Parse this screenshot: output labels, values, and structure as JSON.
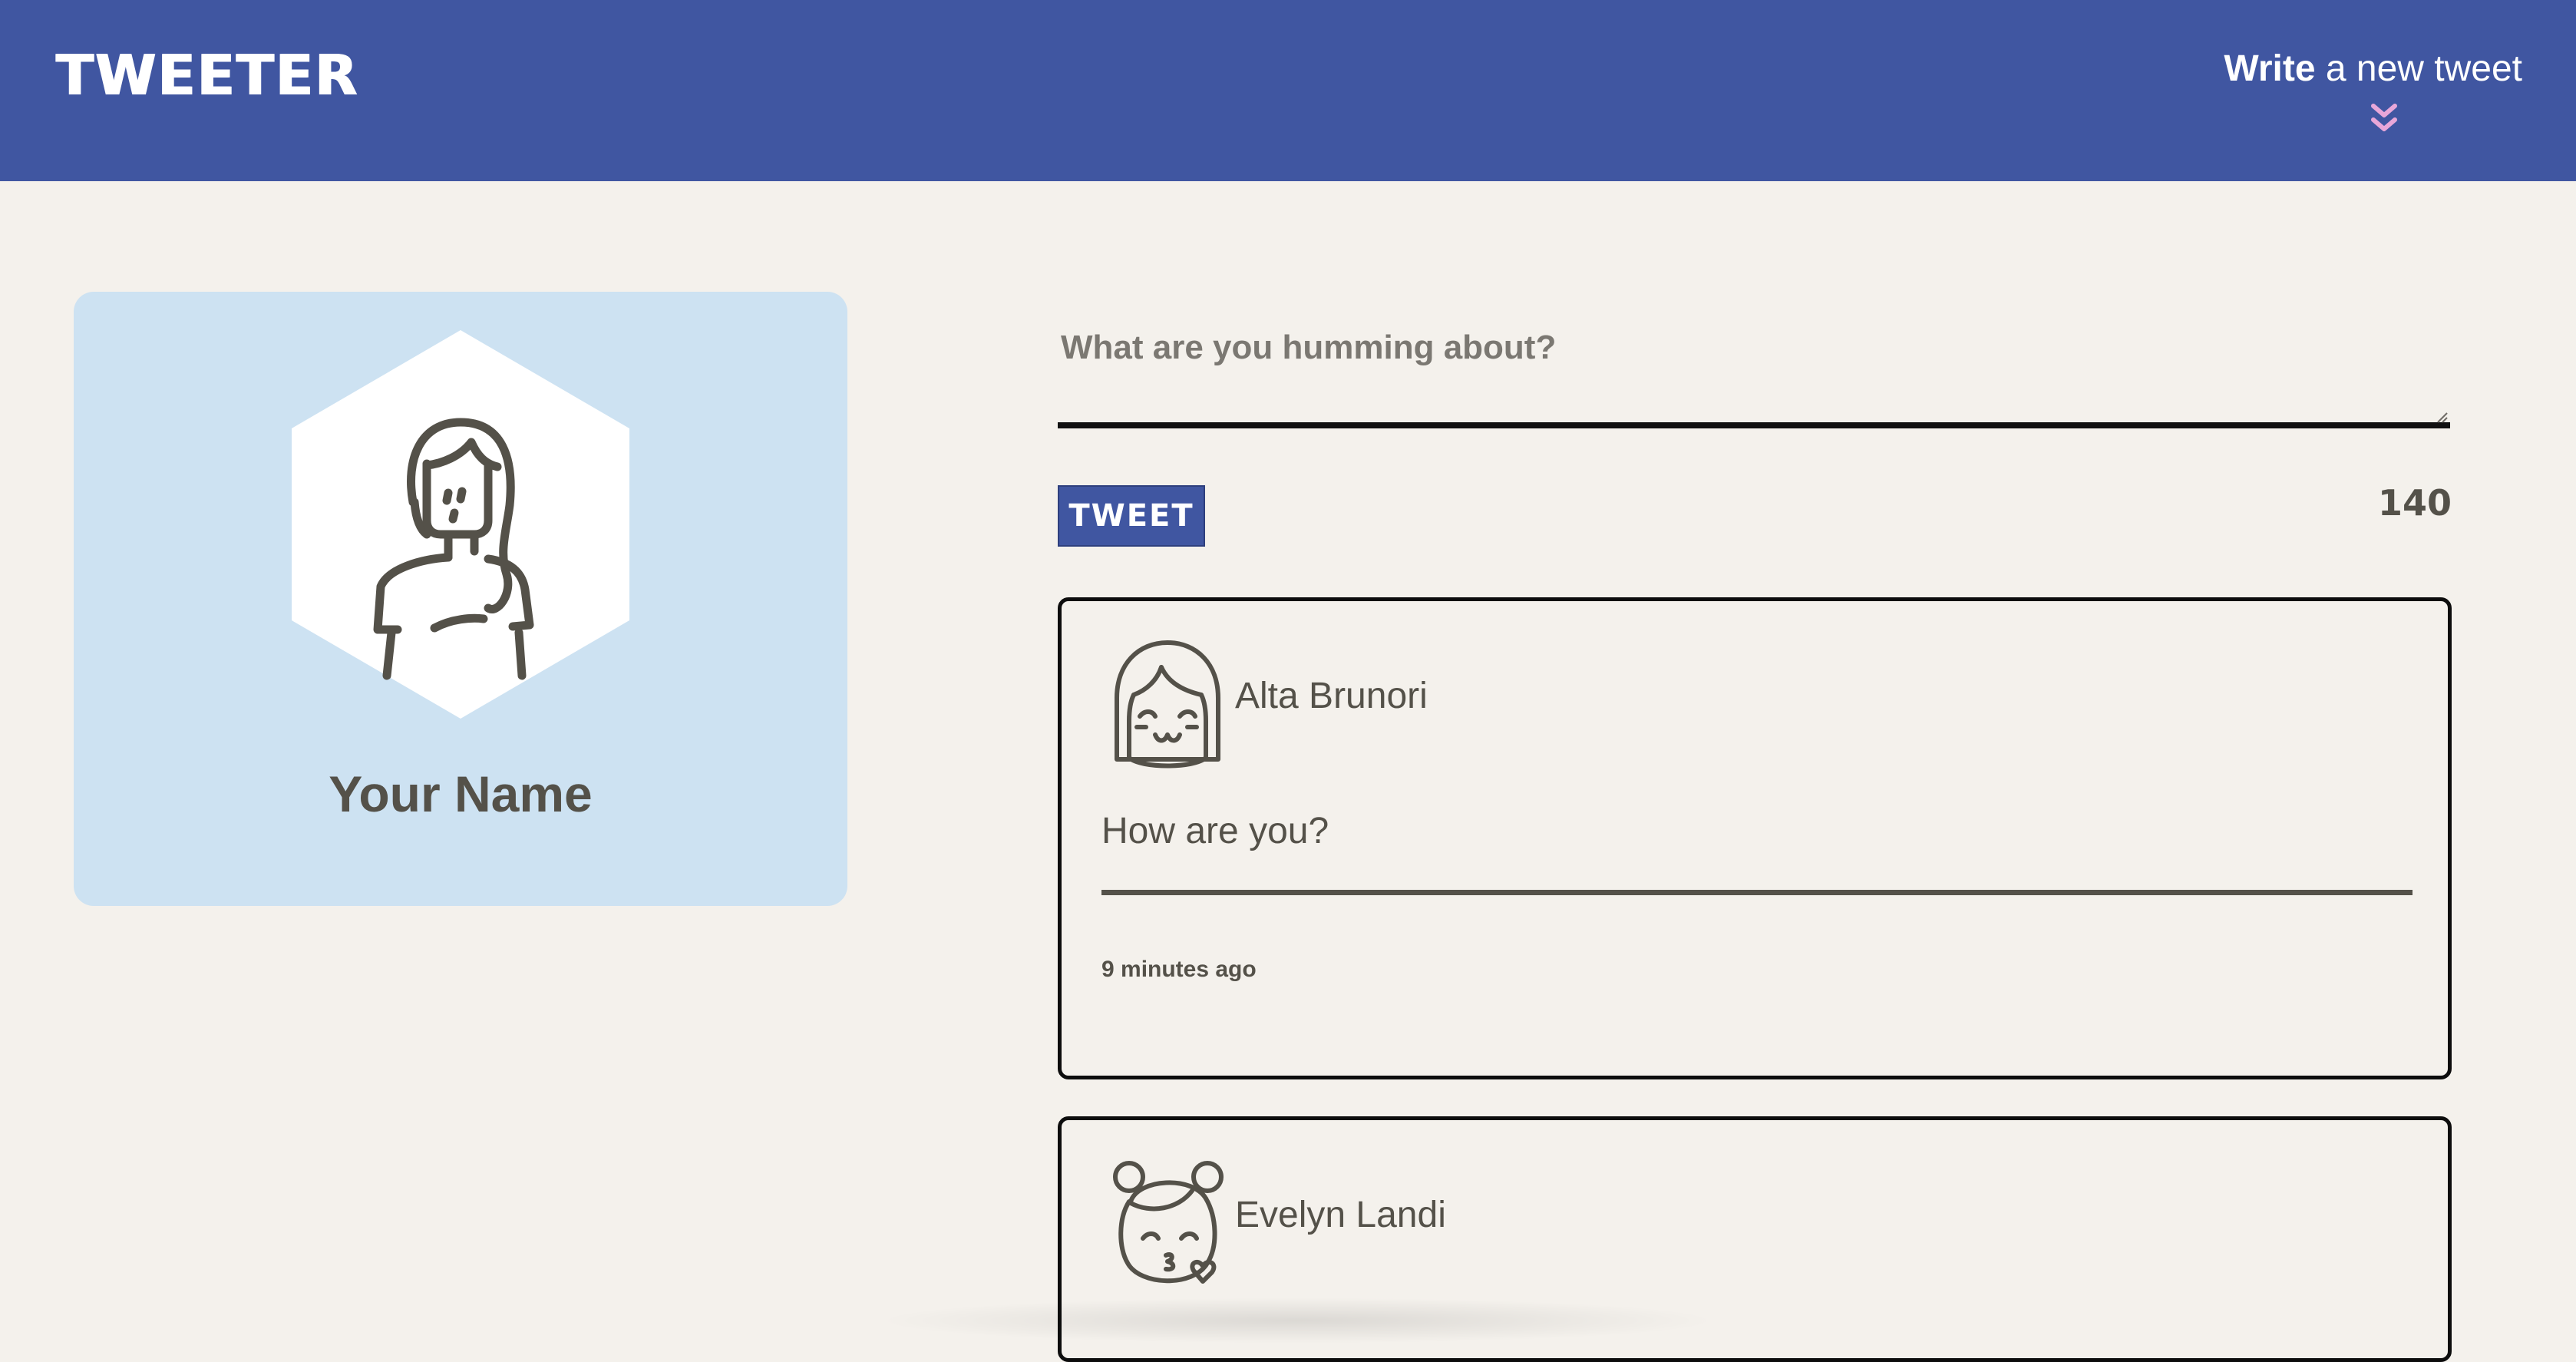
{
  "app": {
    "brand": "TWEETER"
  },
  "nav": {
    "write_strong": "Write",
    "write_rest": " a new tweet",
    "toggle_icon": "double-chevron-down-icon"
  },
  "profile": {
    "name": "Your Name",
    "avatar_icon": "woman-long-hair-avatar-icon"
  },
  "composer": {
    "placeholder": "What are you humming about?",
    "value": "",
    "tweet_label": "TWEET",
    "counter": "140"
  },
  "tweets": [
    {
      "author": "Alta Brunori",
      "avatar_icon": "girl-bangs-smiling-avatar-icon",
      "content": "How are you?",
      "time": "9 minutes ago"
    },
    {
      "author": "Evelyn Landi",
      "avatar_icon": "girl-buns-kiss-avatar-icon",
      "content": "",
      "time": ""
    }
  ],
  "colors": {
    "nav_bg": "#4056a1",
    "page_bg": "#f4f1ec",
    "card_bg": "#cde2f2",
    "text": "#545149",
    "accent_chevron": "#e8a7d9"
  }
}
